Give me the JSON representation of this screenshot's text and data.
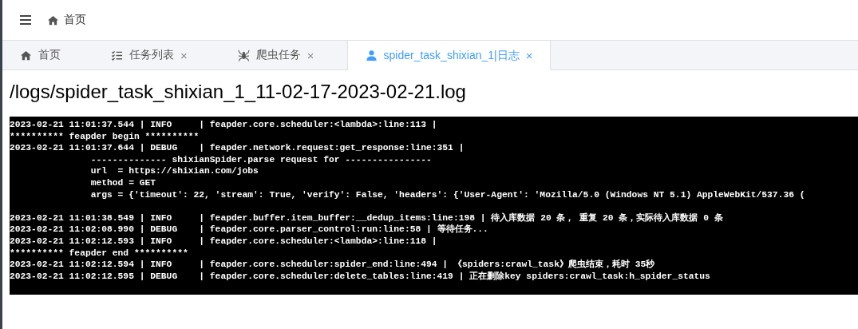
{
  "breadcrumb": {
    "label": "首页"
  },
  "tabs": [
    {
      "label": "首页",
      "closable": false,
      "selected": false
    },
    {
      "label": "任务列表",
      "closable": true,
      "selected": false
    },
    {
      "label": "爬虫任务",
      "closable": true,
      "selected": false
    },
    {
      "label": "spider_task_shixian_1|日志",
      "closable": true,
      "selected": true
    }
  ],
  "close_glyph": "×",
  "file_title": "/logs/spider_task_shixian_1_11-02-17-2023-02-21.log",
  "log_lines": [
    {
      "text": "2023-02-21 11:01:37.544 | INFO     | feapder.core.scheduler:<lambda>:line:113 |",
      "blank_after": false
    },
    {
      "text": "********** feapder begin **********",
      "blank_after": false
    },
    {
      "text": "2023-02-21 11:01:37.644 | DEBUG    | feapder.network.request:get_response:line:351 |",
      "blank_after": false
    },
    {
      "text": "               -------------- shixianSpider.parse request for ----------------",
      "blank_after": false
    },
    {
      "text": "               url  = https://shixian.com/jobs",
      "blank_after": false
    },
    {
      "text": "               method = GET",
      "blank_after": false
    },
    {
      "text": "               args = {'timeout': 22, 'stream': True, 'verify': False, 'headers': {'User-Agent': 'Mozilla/5.0 (Windows NT 5.1) AppleWebKit/537.36 (",
      "blank_after": true
    },
    {
      "text": "2023-02-21 11:01:38.549 | INFO     | feapder.buffer.item_buffer:__dedup_items:line:198 | 待入库数据 20 条， 重复 20 条，实际待入库数据 0 条",
      "blank_after": false
    },
    {
      "text": "2023-02-21 11:02:08.990 | DEBUG    | feapder.core.parser_control:run:line:58 | 等待任务...",
      "blank_after": false
    },
    {
      "text": "2023-02-21 11:02:12.593 | INFO     | feapder.core.scheduler:<lambda>:line:118 |",
      "blank_after": false
    },
    {
      "text": "********** feapder end **********",
      "blank_after": false
    },
    {
      "text": "2023-02-21 11:02:12.594 | INFO     | feapder.core.scheduler:spider_end:line:494 | 《spiders:crawl_task》爬虫结束，耗时 35秒",
      "blank_after": false
    },
    {
      "text": "2023-02-21 11:02:12.595 | DEBUG    | feapder.core.scheduler:delete_tables:line:419 | 正在删除key spiders:crawl_task:h_spider_status",
      "blank_after": false
    }
  ]
}
